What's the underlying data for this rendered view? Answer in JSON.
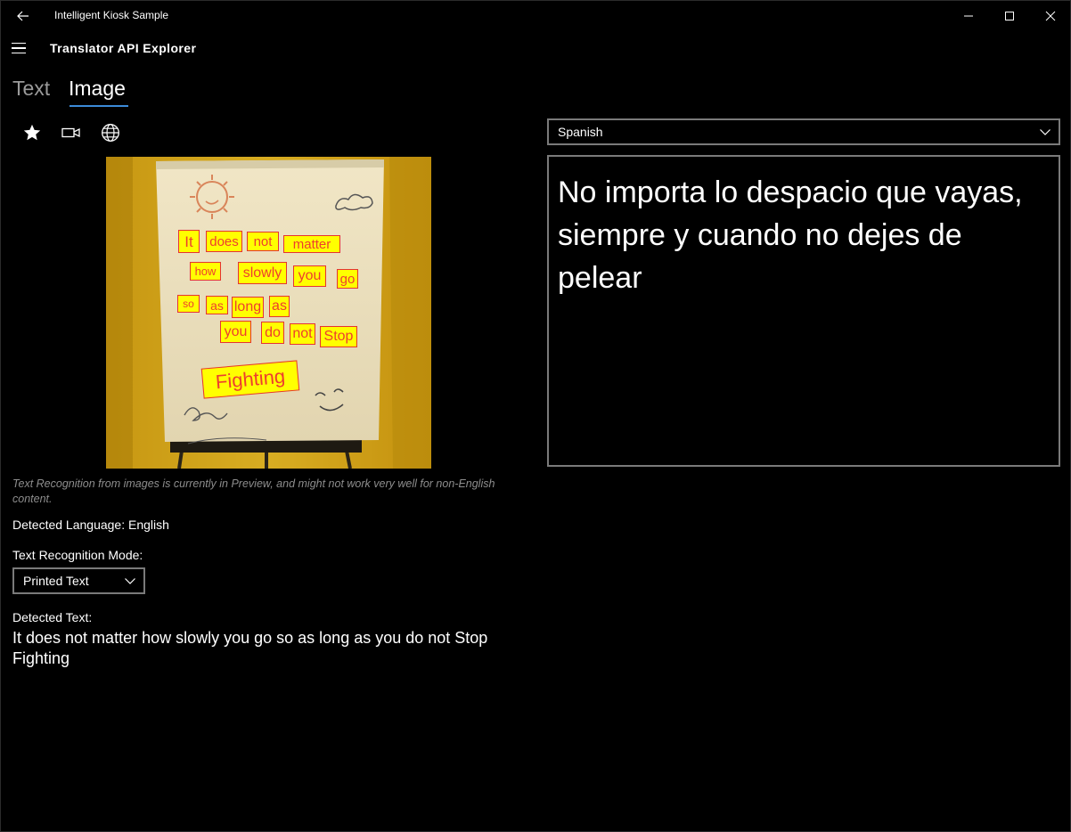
{
  "titlebar": {
    "title": "Intelligent Kiosk Sample",
    "back_icon": "back-arrow-icon",
    "minimize_icon": "minimize-icon",
    "maximize_icon": "maximize-icon",
    "close_icon": "close-icon"
  },
  "header": {
    "menu_icon": "hamburger-menu-icon",
    "title": "Translator API Explorer"
  },
  "tabs": [
    {
      "label": "Text",
      "selected": false
    },
    {
      "label": "Image",
      "selected": true
    }
  ],
  "accent_color": "#3c8bd9",
  "toolbar": {
    "icons": [
      "star-icon",
      "camera-icon",
      "globe-icon"
    ]
  },
  "image_panel": {
    "ocr_words": [
      "It",
      "does",
      "not",
      "matter",
      "how",
      "slowly",
      "you",
      "go",
      "so",
      "as",
      "long",
      "as",
      "you",
      "do",
      "not",
      "Stop",
      "Fighting"
    ],
    "ocr_box_color": "#ffff00",
    "ocr_border_color": "#e53333"
  },
  "preview_note": "Text Recognition from images is currently in Preview, and might not work very well for non-English content.",
  "detected_language": "Detected Language: English",
  "recognition_mode": {
    "label": "Text Recognition Mode:",
    "selected": "Printed Text"
  },
  "detected_text": {
    "label": "Detected Text:",
    "value": "It does not matter how slowly you go so as long as you do not Stop Fighting"
  },
  "target_language": {
    "selected": "Spanish"
  },
  "translation": "No importa lo despacio que vayas, siempre y cuando no dejes de pelear"
}
